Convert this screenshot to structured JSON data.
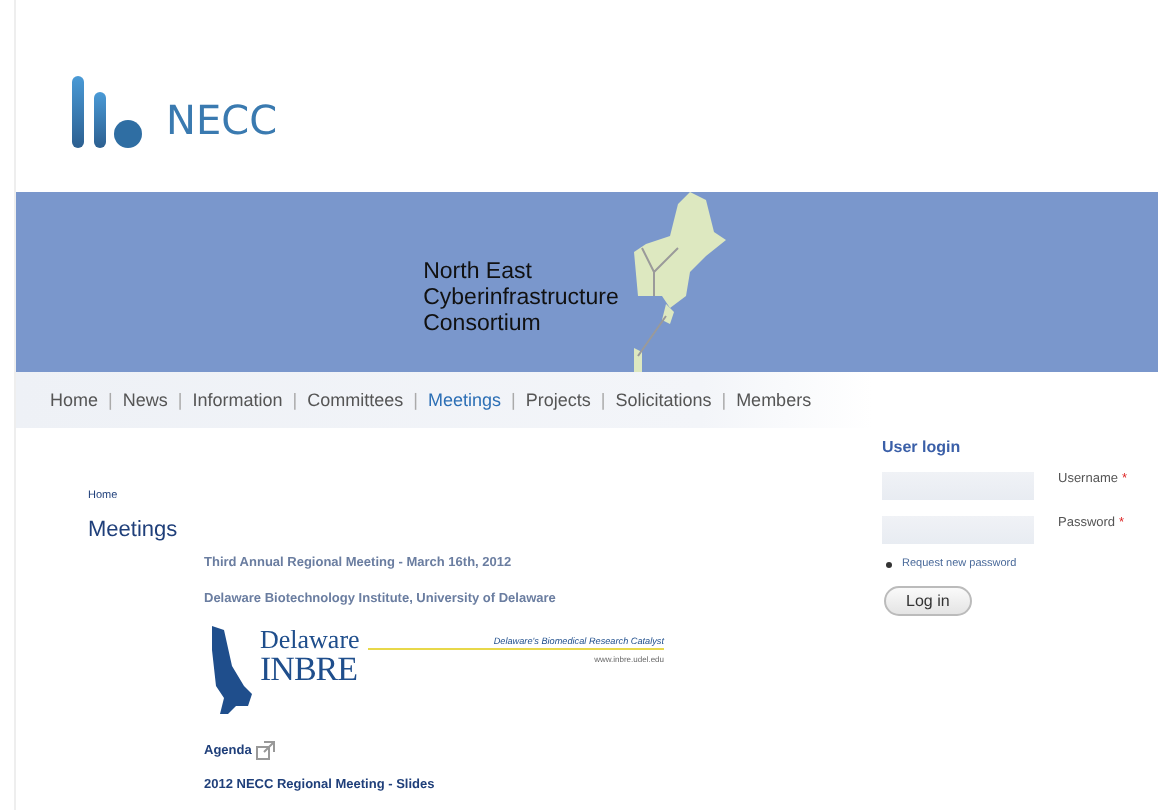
{
  "site": {
    "name": "NECC"
  },
  "banner": {
    "lines": [
      "North East",
      "Cyberinfrastructure",
      "Consortium"
    ]
  },
  "nav": [
    {
      "label": "Home",
      "selected": false
    },
    {
      "separator": "|",
      "label": "News",
      "selected": false
    },
    {
      "separator": "|",
      "label": "Information",
      "selected": false
    },
    {
      "separator": "|",
      "label": "Committees",
      "selected": false
    },
    {
      "separator": "|",
      "label": "Meetings",
      "selected": true
    },
    {
      "separator": "|",
      "label": "Projects",
      "selected": false
    },
    {
      "separator": "|",
      "label": "Solicitations",
      "selected": false
    },
    {
      "separator": "|",
      "label": "Members",
      "selected": false
    }
  ],
  "breadcrumb": "Home",
  "title": "Meetings",
  "content": [
    {
      "kind": "heading",
      "text": "Third Annual Regional Meeting - March 16th, 2012"
    },
    {
      "kind": "heading",
      "text": "Delaware Biotechnology Institute, University of Delaware"
    },
    {
      "kind": "logo",
      "top": "Delaware",
      "bottom": "INBRE",
      "tagline": "Delaware's Biomedical Research Catalyst",
      "url": "www.inbre.udel.edu"
    },
    {
      "kind": "link",
      "text": "Agenda",
      "external": true
    },
    {
      "kind": "link",
      "text": "2012 NECC Regional Meeting - Slides",
      "external": false
    }
  ],
  "login": {
    "title": "User login",
    "fields": [
      {
        "label": "Username",
        "required_mark": "*"
      },
      {
        "label": "Password",
        "required_mark": "*"
      }
    ],
    "links": [
      "Request new password"
    ],
    "button": "Log in"
  }
}
